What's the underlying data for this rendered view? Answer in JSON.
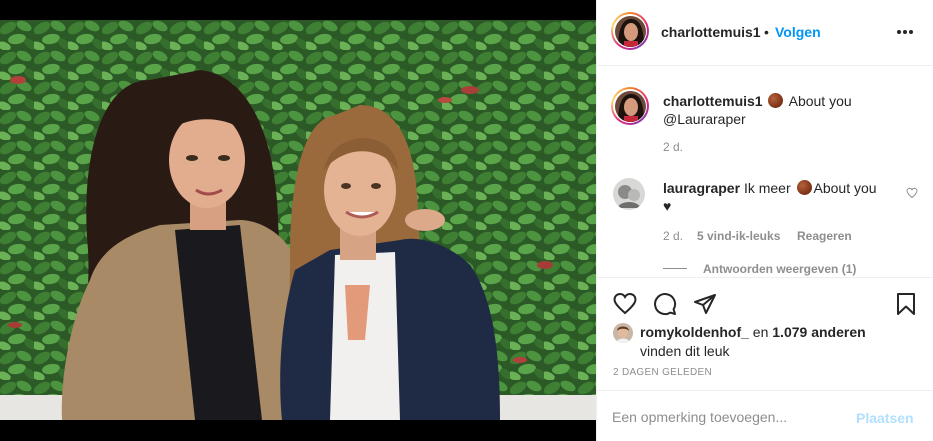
{
  "post": {
    "username": "charlottemuis1",
    "separator": "•",
    "follow_label": "Volgen",
    "more_icon": "more-horizontal-icon"
  },
  "caption": {
    "username": "charlottemuis1",
    "emoji": "basketball-emoji",
    "text": "About you",
    "mention": "@Lauraraper",
    "time": "2 d."
  },
  "comments": [
    {
      "username": "lauragraper",
      "text_before": "Ik meer",
      "emoji": "basketball-emoji",
      "text_after": "About you",
      "heart": "♥",
      "time": "2 d.",
      "likes": "5 vind-ik-leuks",
      "reply_label": "Reageren",
      "view_replies": "Antwoorden weergeven (1)"
    }
  ],
  "actions": {
    "like_icon": "heart-outline-icon",
    "comment_icon": "comment-bubble-icon",
    "share_icon": "paper-plane-icon",
    "save_icon": "bookmark-icon"
  },
  "likes": {
    "first_user": "romykoldenhof_",
    "connector": "en",
    "others": "1.079 anderen",
    "suffix": "vinden dit leuk"
  },
  "timestamp": "2 DAGEN GELEDEN",
  "comment_form": {
    "placeholder": "Een opmerking toevoegen...",
    "post_label": "Plaatsen"
  },
  "colors": {
    "accent": "#0095f6",
    "post_disabled": "#b2dffc",
    "muted": "#8e8e8e",
    "text": "#262626",
    "border": "#efefef"
  }
}
